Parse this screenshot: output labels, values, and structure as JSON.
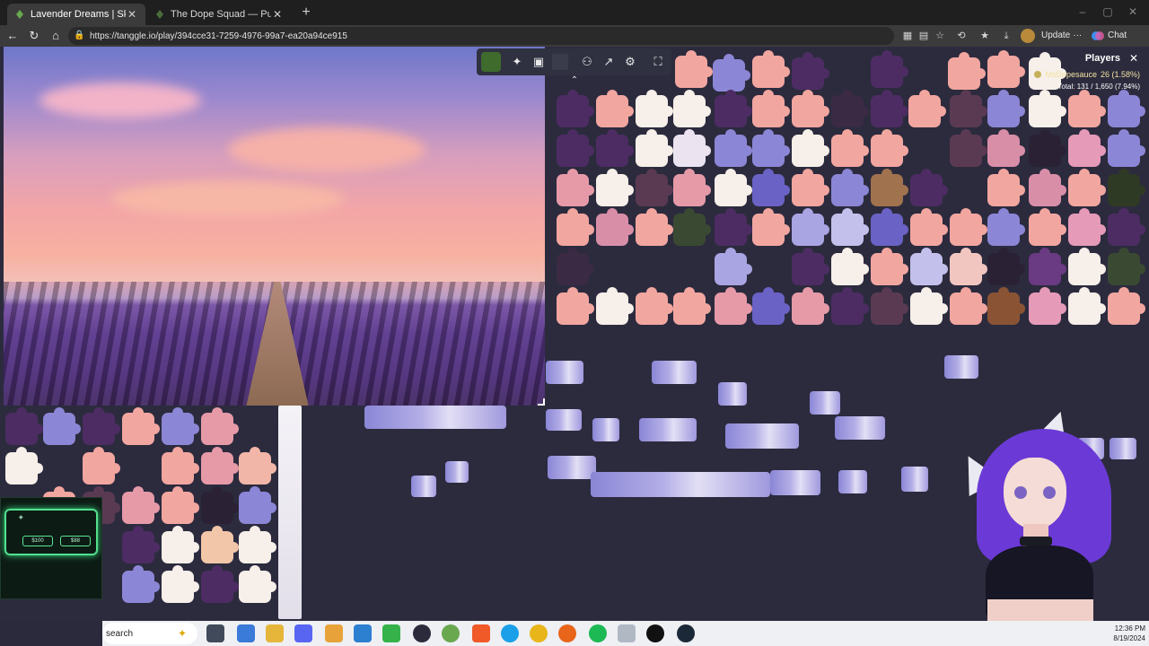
{
  "browser": {
    "tabs": [
      {
        "title": "Lavender Dreams | Sky Jigsaw",
        "active": true
      },
      {
        "title": "The Dope Squad — Puzzles",
        "active": false
      }
    ],
    "url": "https://tanggle.io/play/394cce31-7259-4976-99a7-ea20a94ce915",
    "update_label": "Update",
    "chat_label": "Chat"
  },
  "players_panel": {
    "title": "Players",
    "player_name": "MsDopesauce",
    "player_stats": "26 (1.58%)",
    "total": "Total: 131 / 1,650 (7.94%)"
  },
  "taskbar": {
    "search_placeholder": "search",
    "time": "12:36 PM",
    "date": "8/19/2024"
  },
  "webcam": {
    "left_amount": "$100",
    "right_amount": "$88"
  },
  "colors": {
    "board": "#2c2b3e",
    "piece_peach": "#f2a6a0",
    "piece_lavender": "#8c86d6",
    "piece_dark": "#4d2c63",
    "piece_white": "#f7efe9"
  }
}
